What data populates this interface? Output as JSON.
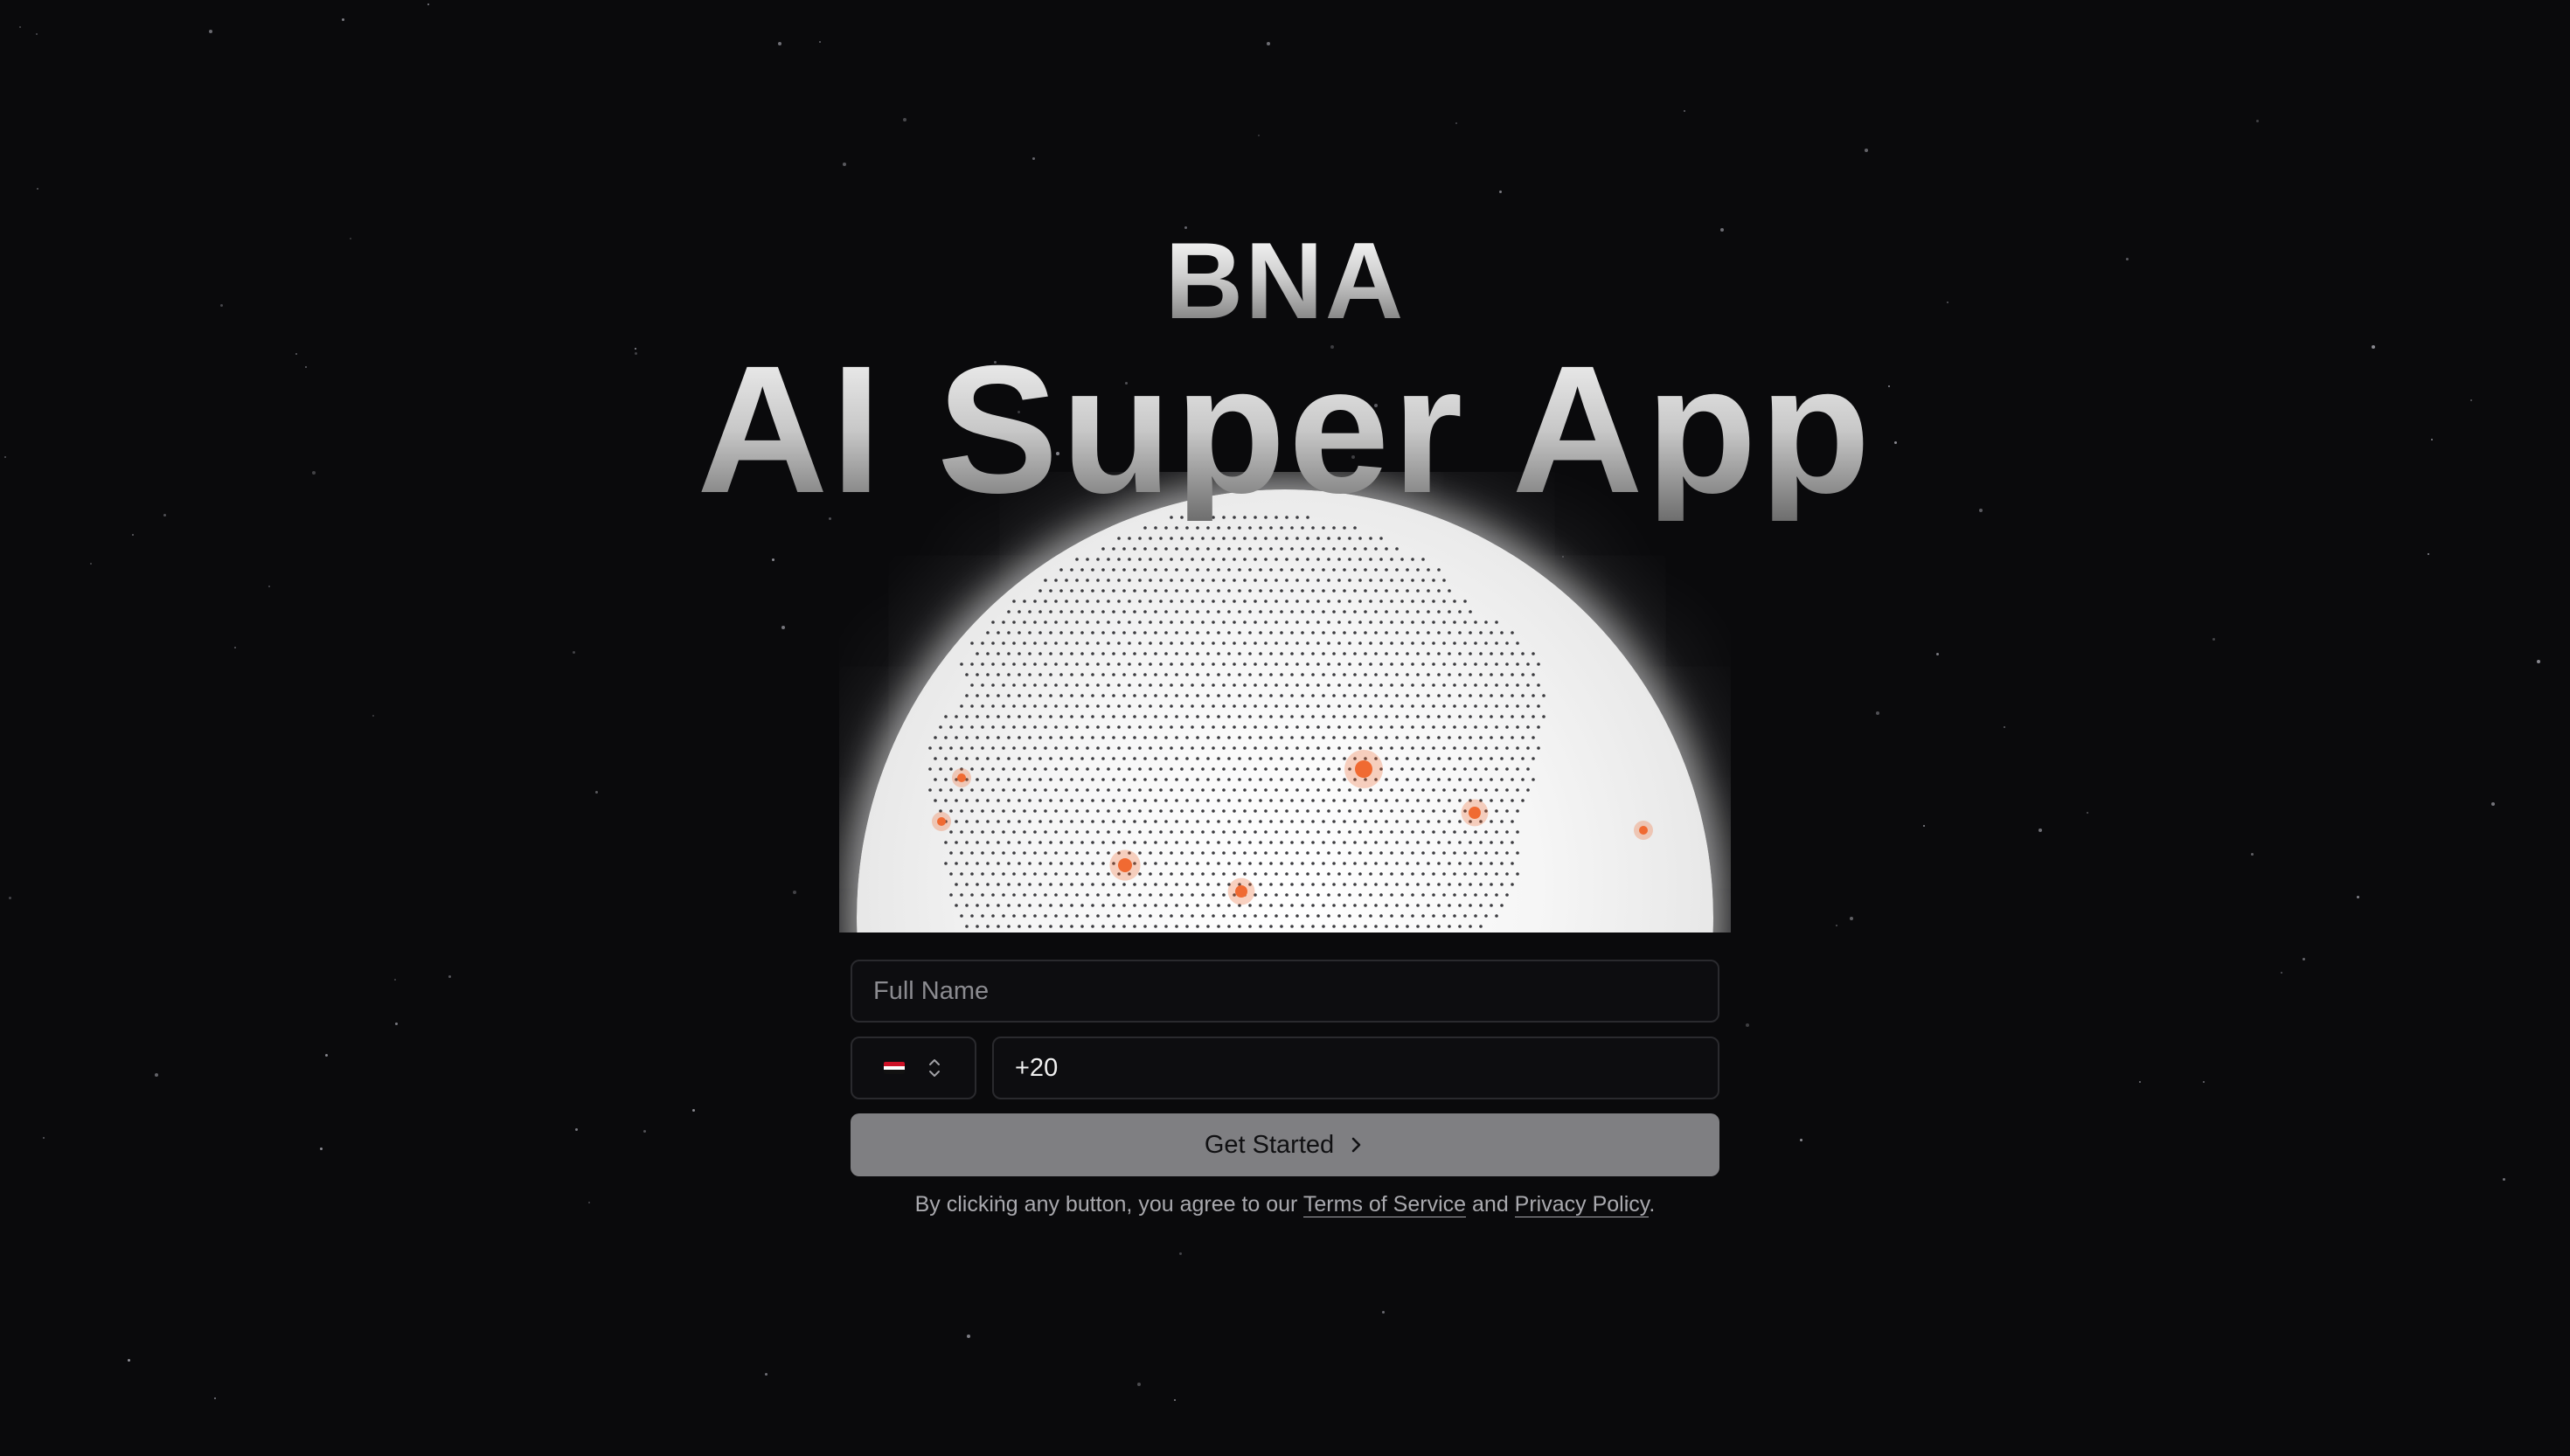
{
  "brand": {
    "name": "BNA",
    "headline": "AI Super App"
  },
  "form": {
    "full_name": {
      "placeholder": "Full Name",
      "value": ""
    },
    "country_selector": {
      "flag": "egypt-flag-icon",
      "chevron": "chevron-up-down-icon"
    },
    "phone": {
      "value": "+20"
    },
    "submit_label": "Get Started",
    "submit_icon": "chevron-right-icon"
  },
  "legal": {
    "prefix": "By clicking any button, you agree to our ",
    "terms_label": "Terms of Service",
    "connector": " and ",
    "privacy_label": "Privacy Policy",
    "suffix": "."
  },
  "colors": {
    "background": "#0a0a0c",
    "accent_dots": "#f06a32",
    "button": "#7f7f82"
  }
}
